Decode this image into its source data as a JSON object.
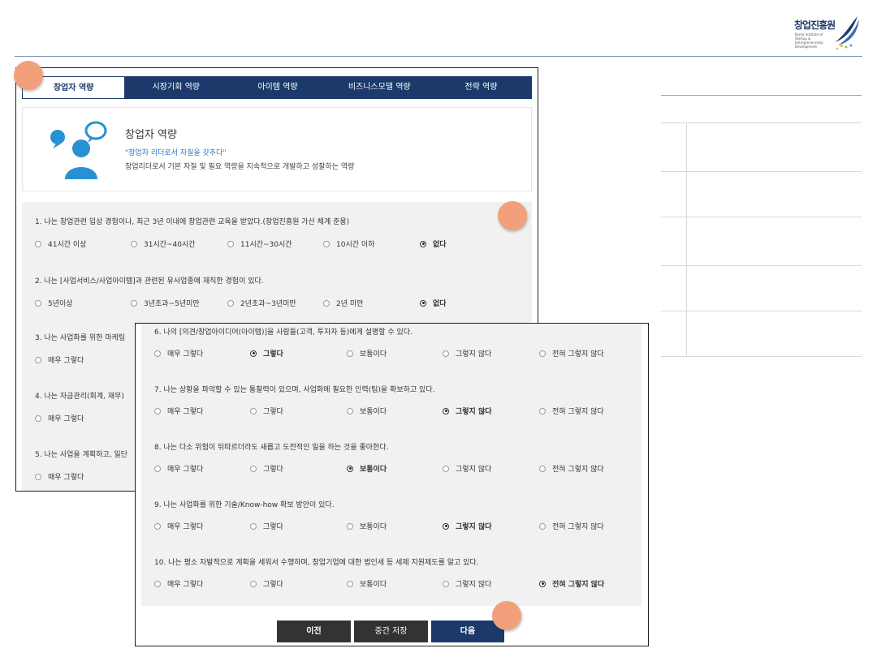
{
  "logo": {
    "title": "창업진흥원",
    "subtitle": "Korea Institute of Startup & Entrepreneurship Development"
  },
  "tabs": [
    "창업자 역량",
    "시장기회 역량",
    "아이템 역량",
    "비즈니스모델 역량",
    "전략 역량"
  ],
  "intro": {
    "title": "창업자 역량",
    "quote": "\"창업자 리더로서 자질을 갖추다\"",
    "description": "창업리더로서 기본 자질 및 필요 역량을 지속적으로 개발하고 성찰하는 역량"
  },
  "panel1_questions": [
    {
      "text": "1.  나는 창업관련 입상 경험이나, 최근 3년 이내에 창업관련 교육을 받았다.(창업진흥원 가산 체계 준용)",
      "options": [
        "41시간 이상",
        "31시간~40시간",
        "11시간~30시간",
        "10시간 이하",
        "없다"
      ],
      "selected": 4
    },
    {
      "text": "2.  나는 [사업서비스/사업아이템]과 관련된 유사업종에 재직한 경험이 있다.",
      "options": [
        "5년이상",
        "3년초과~5년미만",
        "2년초과~3년미만",
        "2년 미만",
        "없다"
      ],
      "selected": 4
    },
    {
      "text": "3.  나는 사업화를 위한 마케팅",
      "options": [
        "매우 그렇다"
      ],
      "selected": -1
    },
    {
      "text": "4.  나는 자금관리(회계, 재무)",
      "options": [
        "매우 그렇다"
      ],
      "selected": -1
    },
    {
      "text": "5.  나는 사업을 계획하고, 일단",
      "options": [
        "매우 그렇다"
      ],
      "selected": -1
    }
  ],
  "panel2_questions": [
    {
      "text": "6.  나의 [의견/창업아이디어(아이템)]을 사람들(고객, 투자자 등)에게 설명할 수 있다.",
      "options": [
        "매우 그렇다",
        "그렇다",
        "보통이다",
        "그렇지 않다",
        "전혀 그렇지 않다"
      ],
      "selected": 1
    },
    {
      "text": "7.  나는 상황을 파악할 수 있는 통찰력이 있으며, 사업화에 필요한 인력(팀)을 확보하고 있다.",
      "options": [
        "매우 그렇다",
        "그렇다",
        "보통이다",
        "그렇지 않다",
        "전혀 그렇지 않다"
      ],
      "selected": 3
    },
    {
      "text": "8.  나는 다소 위험이 뒤따르더라도 새롭고 도전적인 일을 하는 것을 좋아한다.",
      "options": [
        "매우 그렇다",
        "그렇다",
        "보통이다",
        "그렇지 않다",
        "전혀 그렇지 않다"
      ],
      "selected": 2
    },
    {
      "text": "9.  나는 사업화를 위한 기술/Know-how 확보 방안이 있다.",
      "options": [
        "매우 그렇다",
        "그렇다",
        "보통이다",
        "그렇지 않다",
        "전혀 그렇지 않다"
      ],
      "selected": 3
    },
    {
      "text": "10.  나는 평소 자발적으로 계획을 세워서 수행하며, 창업기업에 대한 법인세 등 세제 지원제도를 알고 있다.",
      "options": [
        "매우 그렇다",
        "그렇다",
        "보통이다",
        "그렇지 않다",
        "전혀 그렇지 않다"
      ],
      "selected": 4
    }
  ],
  "buttons": {
    "prev": "이전",
    "save": "중간 저장",
    "next": "다음"
  },
  "colors": {
    "navy": "#1b3a6b",
    "marker": "#f2a07c",
    "accent_line": "#e98a5f",
    "quote": "#2878c8"
  }
}
